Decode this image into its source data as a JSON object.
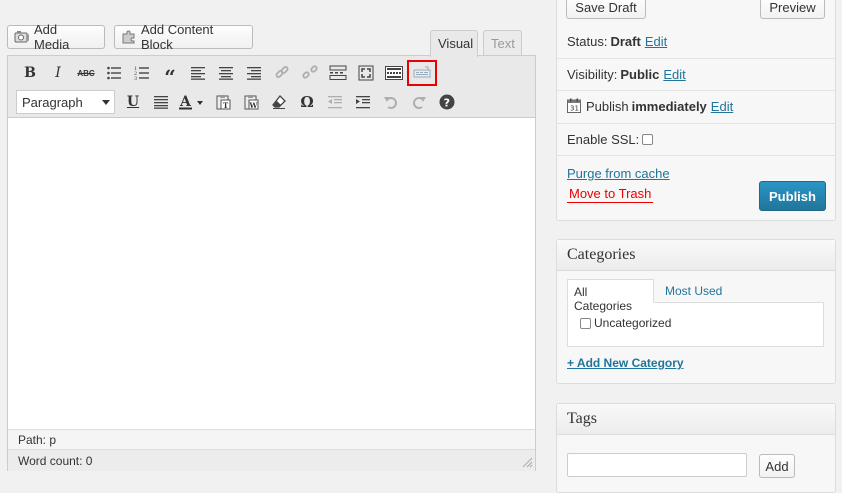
{
  "media_buttons": {
    "add_media": "Add Media",
    "add_content_block": "Add Content Block"
  },
  "editor": {
    "tabs": {
      "visual": "Visual",
      "text": "Text"
    },
    "format_select": "Paragraph",
    "path": "Path: p",
    "word_count": "Word count: 0",
    "toolbar_row1": [
      "bold-icon",
      "italic-icon",
      "strikethrough-icon",
      "bullet-list-icon",
      "numbered-list-icon",
      "blockquote-icon",
      "align-left-icon",
      "align-center-icon",
      "align-right-icon",
      "insert-link-icon",
      "unlink-icon",
      "insert-more-icon",
      "fullscreen-icon",
      "toolbar-toggle-icon",
      "content-block-icon"
    ],
    "toolbar_row2": [
      "underline-icon",
      "justify-icon",
      "text-color-icon",
      "paste-text-icon",
      "paste-word-icon",
      "clear-formatting-icon",
      "special-character-icon",
      "outdent-icon",
      "indent-icon",
      "undo-icon",
      "redo-icon",
      "help-icon"
    ]
  },
  "publish": {
    "save_draft": "Save Draft",
    "preview": "Preview",
    "status_label": "Status:",
    "status_value": "Draft",
    "visibility_label": "Visibility:",
    "visibility_value": "Public",
    "publish_label": "Publish",
    "publish_value": "immediately",
    "edit": "Edit",
    "ssl_label": "Enable SSL:",
    "purge": "Purge from cache",
    "trash": "Move to Trash",
    "publish_button": "Publish"
  },
  "categories": {
    "title": "Categories",
    "tab_all": "All Categories",
    "tab_used": "Most Used",
    "items": [
      "Uncategorized"
    ],
    "add_new": "+ Add New Category"
  },
  "tags": {
    "title": "Tags",
    "add_button": "Add"
  },
  "colors": {
    "link": "#21759b",
    "publish_bg": "#21759b",
    "trash": "#ee0000",
    "highlight": "#ee0000"
  }
}
